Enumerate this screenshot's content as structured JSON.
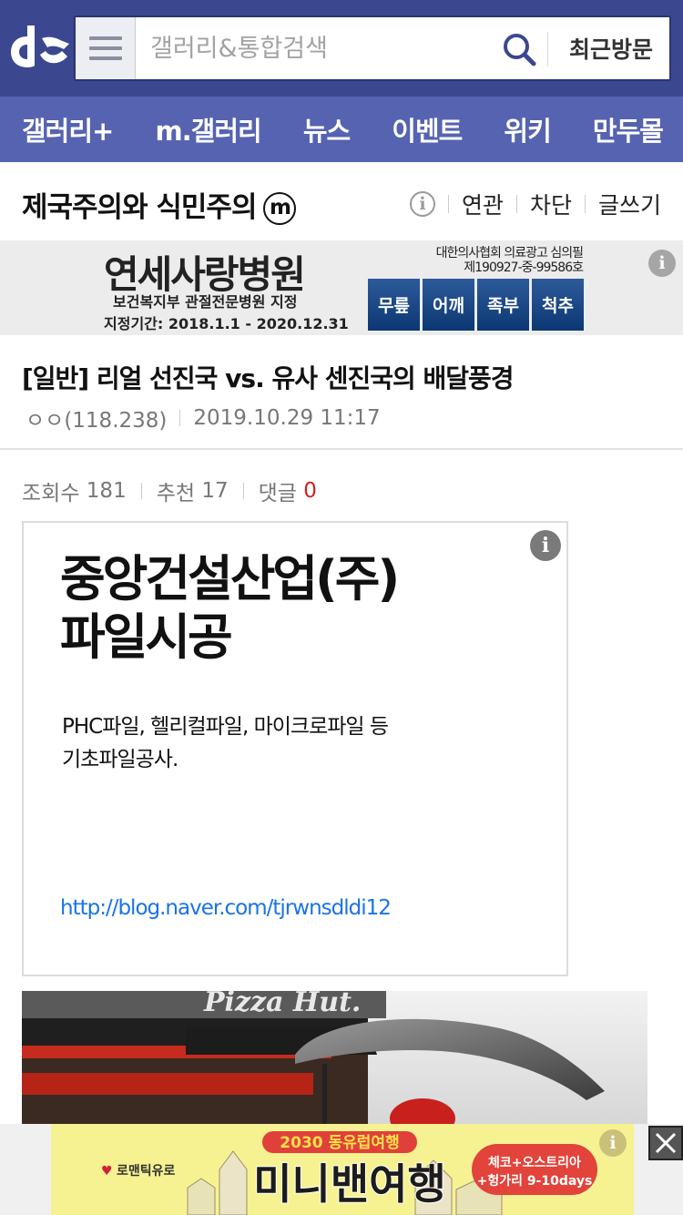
{
  "header": {
    "logo_alt": "dc",
    "search_placeholder": "갤러리&통합검색",
    "recent_label": "최근방문"
  },
  "nav": {
    "items": [
      {
        "label": "갤러리+"
      },
      {
        "label": "m.갤러리"
      },
      {
        "label": "뉴스"
      },
      {
        "label": "이벤트"
      },
      {
        "label": "위키"
      },
      {
        "label": "만두몰"
      }
    ]
  },
  "gallery": {
    "title": "제국주의와 식민주의",
    "badge": "m",
    "actions": {
      "info": "i",
      "related": "연관",
      "block": "차단",
      "write": "글쓰기"
    }
  },
  "top_ad": {
    "name": "연세사랑병원",
    "sub1": "보건복지부 관절전문병원 지정",
    "sub2": "지정기간: 2018.1.1 - 2020.12.31",
    "notice_line1": "대한의사협회 의료광고 심의필",
    "notice_line2": "제190927-중-99586호",
    "tags": [
      "무릎",
      "어깨",
      "족부",
      "척추"
    ],
    "info": "i"
  },
  "post": {
    "title": "[일반] 리얼 선진국 vs. 유사 센진국의 배달풍경",
    "author": "ㅇㅇ(118.238)",
    "datetime": "2019.10.29 11:17",
    "stats": {
      "views_label": "조회수",
      "views": "181",
      "recommend_label": "추천",
      "recommend": "17",
      "comments_label": "댓글",
      "comments": "0"
    }
  },
  "body_ad": {
    "title_line1": "중앙건설산업(주)",
    "title_line2": "파일시공",
    "desc_line1": "PHC파일, 헬리컬파일, 마이크로파일 등",
    "desc_line2": "기초파일공사.",
    "link": "http://blog.naver.com/tjrwnsdldi12",
    "info": "i"
  },
  "photo": {
    "sign_text": "Pizza Hut."
  },
  "bottom_ad": {
    "brand": "로맨틱유로",
    "banner_top": "2030 동유럽여행",
    "banner_main": "미니밴여행",
    "badge_line1": "체코+오스트리아",
    "badge_line2": "+헝가리 9-10days",
    "info": "i"
  }
}
